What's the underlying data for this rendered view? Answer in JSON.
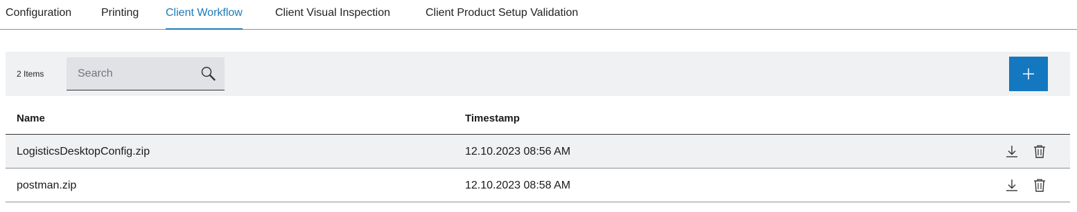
{
  "tabs": [
    {
      "label": "Configuration",
      "active": false
    },
    {
      "label": "Printing",
      "active": false
    },
    {
      "label": "Client Workflow",
      "active": true
    },
    {
      "label": "Client Visual Inspection",
      "active": false
    },
    {
      "label": "Client Product Setup Validation",
      "active": false
    }
  ],
  "toolbar": {
    "item_count": "2 Items",
    "search_placeholder": "Search",
    "search_value": "",
    "add_icon": "plus-icon"
  },
  "table": {
    "columns": {
      "name": "Name",
      "timestamp": "Timestamp"
    },
    "rows": [
      {
        "name": "LogisticsDesktopConfig.zip",
        "timestamp": "12.10.2023 08:56 AM"
      },
      {
        "name": "postman.zip",
        "timestamp": "12.10.2023 08:58 AM"
      }
    ],
    "row_actions": [
      "download-icon",
      "delete-icon"
    ]
  },
  "colors": {
    "accent": "#1a7ab8",
    "button": "#1478c1",
    "toolbar_bg": "#eff1f2",
    "search_bg": "#e0e2e5"
  }
}
